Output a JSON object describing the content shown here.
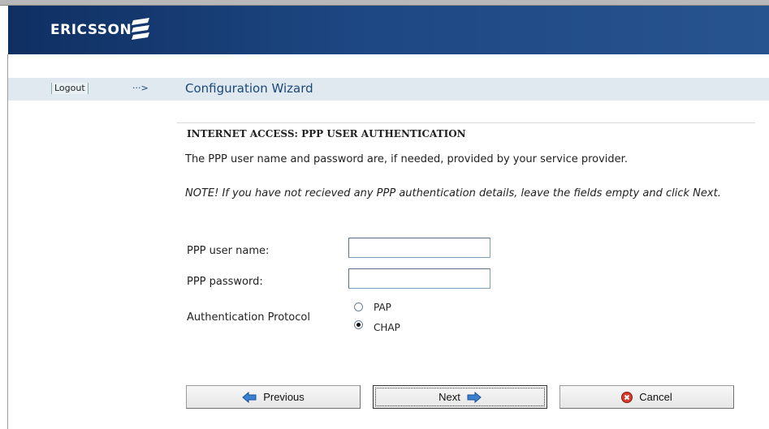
{
  "header": {
    "brand": "ERICSSON"
  },
  "nav": {
    "logout_label": "Logout",
    "arrow": "···>",
    "title": "Configuration Wizard"
  },
  "section": {
    "title": "INTERNET ACCESS: PPP USER AUTHENTICATION",
    "intro": "The PPP user name and password are, if needed, provided by your service provider.",
    "note": "NOTE! If you have not recieved any PPP authentication details, leave the fields empty and click Next."
  },
  "form": {
    "username_label": "PPP user name:",
    "username_value": "",
    "password_label": "PPP password:",
    "password_value": "",
    "auth_label": "Authentication Protocol",
    "options": [
      {
        "label": "PAP",
        "checked": false
      },
      {
        "label": "CHAP",
        "checked": true
      }
    ]
  },
  "buttons": {
    "previous": "Previous",
    "next": "Next",
    "cancel": "Cancel"
  },
  "colors": {
    "banner": "#1d4782",
    "navbar": "#dfe9ef",
    "title": "#1c4878"
  },
  "icons": [
    "ericsson-logo-icon",
    "arrow-left-icon",
    "arrow-right-icon",
    "cancel-icon"
  ]
}
